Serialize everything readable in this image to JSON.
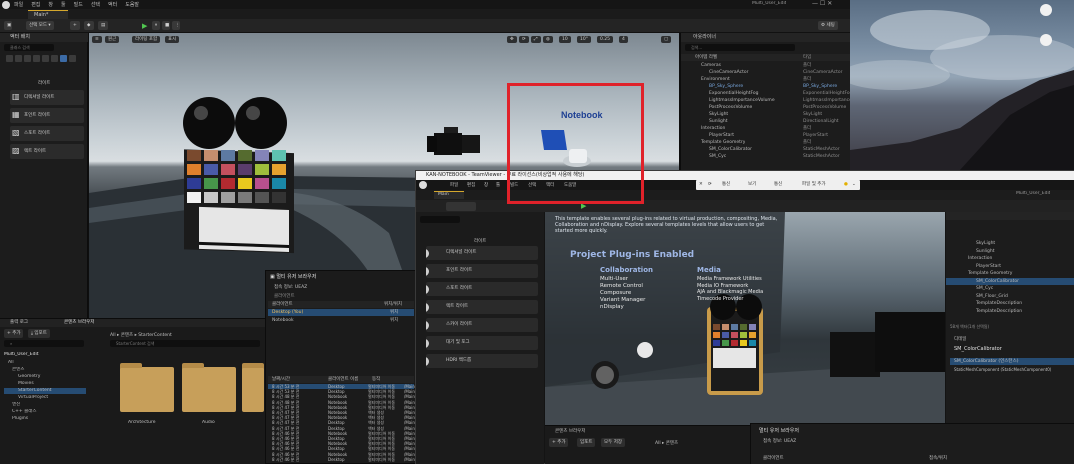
{
  "editor": {
    "menu": [
      "파일",
      "편집",
      "창",
      "툴",
      "빌드",
      "선택",
      "액터",
      "도움말"
    ],
    "tab_label": "Main*",
    "window_title": "Multi_User_Edit",
    "settings_label": "세팅",
    "select_mode": "선택 모드",
    "toolbar_buttons": [
      "원근",
      "라이팅 포함",
      "표시"
    ],
    "toolbar_grid_values": [
      "10",
      "10°",
      "0.25",
      "4"
    ]
  },
  "place_actors": {
    "title": "액터 배치",
    "search_placeholder": "클래스 검색",
    "category_caption": "라이트",
    "items": [
      "디렉셔널 라이트",
      "포인트 라이트",
      "스포트 라이트",
      "렉트 라이트"
    ]
  },
  "viewport": {
    "scene_label": "Notebook"
  },
  "outliner": {
    "title": "아웃라이너",
    "search_placeholder": "검색...",
    "columns": [
      "아이템 라벨",
      "타입"
    ],
    "rows": [
      {
        "name": "Cameras",
        "type": "폴더"
      },
      {
        "name": "CineCameraActor",
        "type": "CineCameraActor"
      },
      {
        "name": "Environment",
        "type": "폴더"
      },
      {
        "name": "BP_Sky_Sphere",
        "type": "BP_Sky_Sphere"
      },
      {
        "name": "ExponentialHeightFog",
        "type": "ExponentialHeightFog"
      },
      {
        "name": "LightmassImportanceVolume",
        "type": "LightmassImportanceVolume"
      },
      {
        "name": "PostProcessVolume",
        "type": "PostProcessVolume"
      },
      {
        "name": "SkyLight",
        "type": "SkyLight"
      },
      {
        "name": "Sunlight",
        "type": "DirectionalLight"
      },
      {
        "name": "Interaction",
        "type": "폴더"
      },
      {
        "name": "PlayerStart",
        "type": "PlayerStart"
      },
      {
        "name": "Template Geometry",
        "type": "폴더"
      },
      {
        "name": "SM_ColorCalibrator",
        "type": "StaticMeshActor"
      },
      {
        "name": "SM_Cyc",
        "type": "StaticMeshActor"
      }
    ]
  },
  "content_browser": {
    "tabs": [
      "출력 로그",
      "콘텐츠 브라우저"
    ],
    "add_label": "추가",
    "import_label": "임포트",
    "path": [
      "All",
      "콘텐츠",
      "StarterContent"
    ],
    "search_placeholder": "StarterContent 검색",
    "tree_root": "Multi_User_Edit",
    "tree": [
      "All",
      "콘텐츠",
      "Geometry",
      "Movies",
      "StarterContent",
      "VirtualProject",
      "엔진",
      "C++ 클래스",
      "Plugins"
    ],
    "folders": [
      "Architecture",
      "Audio",
      "Blueprints"
    ]
  },
  "collab": {
    "title": "멀티 유저 브라우저",
    "session_label": "접속 정보: UEAZ",
    "subheading": "클라이언트",
    "columns": [
      "클라이언트",
      "위치/위치"
    ],
    "clients": [
      {
        "name": "Desktop (You)",
        "location": "위치"
      },
      {
        "name": "Notebook",
        "location": "위치"
      }
    ],
    "history_columns": [
      "날짜/시간",
      "클라이언트 이름",
      "동작"
    ],
    "history": [
      {
        "time": "8 시간 53 분 전",
        "client": "Desktop",
        "op": "멀티미디어 이동"
      },
      {
        "time": "8 시간 53 분 전",
        "client": "Desktop",
        "op": "멀티미디어 이동"
      },
      {
        "time": "8 시간 48 분 전",
        "client": "Notebook",
        "op": "멀티미디어 이동"
      },
      {
        "time": "8 시간 48 분 전",
        "client": "Notebook",
        "op": "멀티미디어 이동"
      },
      {
        "time": "8 시간 47 분 전",
        "client": "Notebook",
        "op": "멀티미디어 이동"
      },
      {
        "time": "8 시간 47 분 전",
        "client": "Notebook",
        "op": "액터 생성"
      },
      {
        "time": "8 시간 47 분 전",
        "client": "Notebook",
        "op": "액터 생성"
      },
      {
        "time": "8 시간 47 분 전",
        "client": "Desktop",
        "op": "액터 생성"
      },
      {
        "time": "8 시간 47 분 전",
        "client": "Desktop",
        "op": "액터 생성"
      },
      {
        "time": "8 시간 46 분 전",
        "client": "Notebook",
        "op": "멀티미디어 이동"
      },
      {
        "time": "8 시간 46 분 전",
        "client": "Desktop",
        "op": "멀티미디어 이동"
      },
      {
        "time": "8 시간 46 분 전",
        "client": "Notebook",
        "op": "멀티미디어 이동"
      },
      {
        "time": "8 시간 46 분 전",
        "client": "Desktop",
        "op": "멀티미디어 이동"
      },
      {
        "time": "8 시간 46 분 전",
        "client": "Notebook",
        "op": "멀티미디어 이동"
      },
      {
        "time": "8 시간 46 분 전",
        "client": "Desktop",
        "op": "멀티미디어 이동"
      }
    ],
    "history_suffix": "/Main"
  },
  "teamviewer": {
    "title": "KAN-NOTEBOOK - TeamViewer - 무료 라이선스(비상업적 사용에 해당)",
    "tab_label": "Main",
    "menu": [
      "파일",
      "편집",
      "창",
      "툴",
      "빌드",
      "선택",
      "액터",
      "도움말"
    ],
    "tools": [
      "통신",
      "보기",
      "통신",
      "파일 및 추가"
    ],
    "window_title": "Multi_User_Edit",
    "left_items": [
      "디렉셔널 라이트",
      "포인트 라이트",
      "스포트 라이트",
      "렉트 라이트",
      "스카이 라이트",
      "대기 및 포그",
      "HDRI 백드롭"
    ],
    "left_caption": "라이트",
    "viewport_text": {
      "headline": "Project Plug-ins Enabled",
      "intro": "This template enables several plug-ins related to virtual production, compositing, Media, Collaboration and nDisplay. Explore several templates levels that allow users to get started more quickly.",
      "col1_title": "Collaboration",
      "col1_items": [
        "Multi-User",
        "Remote Control",
        "Composure",
        "Variant Manager",
        "nDisplay"
      ],
      "col2_title": "Media",
      "col2_items": [
        "Media Framework Utilities",
        "Media IO Framework",
        "AJA and Blackmagic Media",
        "Timecode Provider"
      ]
    },
    "outliner_rows": [
      "SkyLight",
      "Sunlight",
      "Interaction",
      "PlayerStart",
      "Template Geometry",
      "SM_ColorCalibrator",
      "SM_Cyc",
      "SM_Floor_Grid",
      "TemplateDescription",
      "TemplateDescription"
    ],
    "outliner_footer": "58개 액터(1개 선택됨)",
    "details_title": "디테일",
    "details_item": "SM_ColorCalibrator",
    "details_sub": "SM_ColorCalibrator (인스턴스)",
    "details_comp": "StaticMeshComponent (StaticMeshComponent0)",
    "bottom_tab": "콘텐츠 브라우저",
    "bottom_add": "추가",
    "bottom_import": "임포트",
    "bottom_save": "모두 저장",
    "bottom_path": [
      "All",
      "콘텐츠"
    ],
    "collab_title": "멀티 유저 브라우저",
    "collab_session": "접속 정보: UEAZ",
    "collab_col": "클라이언트",
    "collab_col2": "접속/위치"
  },
  "colors": {
    "highlight": "#e0222a",
    "selection": "#264c73",
    "accent": "#d5a82d",
    "notebook_label": "#1d3f93"
  }
}
